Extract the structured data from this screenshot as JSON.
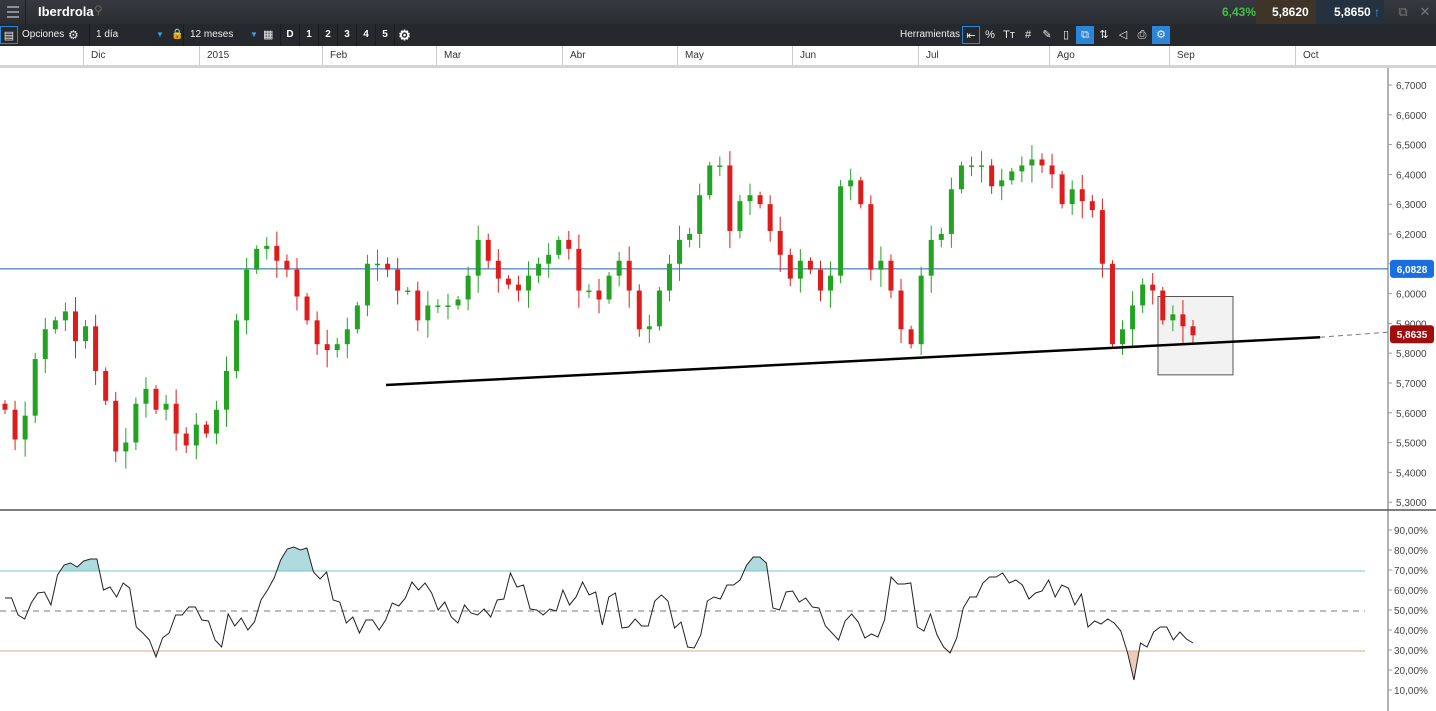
{
  "header": {
    "title": "Iberdrola",
    "change_pct": "6,43%",
    "sell_price": "5,8620",
    "buy_price": "5,8650"
  },
  "toolbar": {
    "options_label": "Opciones",
    "interval": "1 día",
    "range": "12 meses",
    "periods": [
      "D",
      "1",
      "2",
      "3",
      "4",
      "5"
    ],
    "tools_label": "Herramientas",
    "percent_label": "%",
    "text_label": "Tт"
  },
  "time_axis": [
    "Dic",
    "2015",
    "Feb",
    "Mar",
    "Abr",
    "May",
    "Jun",
    "Jul",
    "Ago",
    "Sep",
    "Oct"
  ],
  "colors": {
    "up": "#22a322",
    "down": "#dd1c1c",
    "hline": "#1f5fb8",
    "overbought": "#7ac3c9",
    "oversold": "#d9a98a"
  },
  "chart_data": {
    "type": "candlestick",
    "title": "Iberdrola",
    "price_axis": {
      "ticks": [
        "6,7000",
        "6,6000",
        "6,5000",
        "6,4000",
        "6,3000",
        "6,2000",
        "6,1000",
        "6,0000",
        "5,9000",
        "5,8000",
        "5,7000",
        "5,6000",
        "5,5000",
        "5,4000",
        "5,3000"
      ],
      "range": [
        5.3,
        6.7
      ]
    },
    "closes": [
      5.61,
      5.51,
      5.59,
      5.78,
      5.88,
      5.91,
      5.94,
      5.84,
      5.89,
      5.74,
      5.64,
      5.47,
      5.5,
      5.63,
      5.68,
      5.61,
      5.63,
      5.53,
      5.49,
      5.56,
      5.53,
      5.61,
      5.74,
      5.91,
      6.08,
      6.15,
      6.16,
      6.11,
      6.08,
      5.99,
      5.91,
      5.83,
      5.81,
      5.83,
      5.88,
      5.96,
      6.1,
      6.1,
      6.08,
      6.01,
      6.01,
      5.91,
      5.96,
      5.96,
      5.96,
      5.98,
      6.06,
      6.18,
      6.11,
      6.05,
      6.03,
      6.01,
      6.06,
      6.1,
      6.13,
      6.18,
      6.15,
      6.01,
      6.01,
      5.98,
      6.06,
      6.11,
      6.01,
      5.88,
      5.89,
      6.01,
      6.1,
      6.18,
      6.2,
      6.33,
      6.43,
      6.43,
      6.21,
      6.31,
      6.33,
      6.3,
      6.21,
      6.13,
      6.05,
      6.11,
      6.08,
      6.01,
      6.06,
      6.36,
      6.38,
      6.3,
      6.08,
      6.11,
      6.01,
      5.88,
      5.83,
      6.06,
      6.18,
      6.2,
      6.35,
      6.43,
      6.43,
      6.43,
      6.36,
      6.38,
      6.41,
      6.43,
      6.45,
      6.43,
      6.4,
      6.3,
      6.35,
      6.31,
      6.28,
      6.1,
      5.83,
      5.88,
      5.96,
      6.03,
      6.01,
      5.91,
      5.93,
      5.89,
      5.86
    ],
    "horizontal_line": {
      "value": 6.0828,
      "label": "6,0828"
    },
    "last_price": {
      "value": 5.8635,
      "label": "5,8635"
    },
    "trendline": {
      "start": 5.693,
      "end": 5.8635
    },
    "box": {
      "top": 5.99,
      "bottom": 5.727
    },
    "rsi": {
      "axis_ticks": [
        "90,00%",
        "80,00%",
        "70,00%",
        "60,00%",
        "50,00%",
        "40,00%",
        "30,00%",
        "20,00%",
        "10,00%"
      ],
      "range": [
        0,
        100
      ],
      "levels": [
        70,
        50,
        30
      ],
      "values": [
        56.5,
        56.5,
        48,
        46,
        54,
        59,
        59.5,
        53,
        68,
        73,
        74,
        72,
        75,
        76,
        76,
        60.5,
        62,
        57,
        64,
        61.5,
        42,
        39,
        35.5,
        27,
        36.5,
        39,
        48,
        48,
        52,
        52,
        45.5,
        45,
        35.5,
        32,
        48.5,
        42.5,
        46.5,
        40.5,
        44.5,
        55.5,
        60.5,
        66.5,
        75.5,
        81,
        82,
        80.5,
        81.5,
        69.5,
        66,
        69.5,
        55.5,
        54.5,
        44,
        47,
        39,
        45.5,
        45.5,
        40.5,
        45.5,
        54,
        52.5,
        56.5,
        64.5,
        60.5,
        64,
        59,
        50.5,
        54.5,
        47,
        44,
        53,
        49,
        48,
        51,
        47,
        55.5,
        56,
        69,
        62,
        63,
        51,
        50.5,
        48,
        51,
        50,
        60.5,
        53,
        57,
        64.5,
        58,
        59.5,
        43,
        57,
        59,
        41.5,
        42,
        46,
        42.5,
        42.5,
        55,
        58,
        55,
        41.5,
        44.5,
        32,
        31.5,
        38,
        55,
        57,
        56,
        63,
        63,
        65.5,
        73,
        77,
        77,
        74,
        51.5,
        50.5,
        59.5,
        60,
        54.5,
        56.5,
        52,
        51.5,
        42.5,
        39,
        35.5,
        45,
        48.5,
        44.5,
        36.5,
        38.5,
        37,
        45.5,
        67,
        63.5,
        63.5,
        64,
        42,
        40,
        48.5,
        38,
        32,
        29,
        36.5,
        51.5,
        57,
        57,
        64,
        67,
        67,
        69,
        64,
        65.5,
        63,
        56,
        59,
        60,
        65.5,
        57,
        63,
        61.5,
        53,
        58.5,
        42,
        45,
        43.5,
        46,
        44,
        40,
        29.5,
        15.5,
        34,
        32,
        39.5,
        42,
        42,
        35.5,
        39.5,
        36,
        34
      ]
    }
  }
}
